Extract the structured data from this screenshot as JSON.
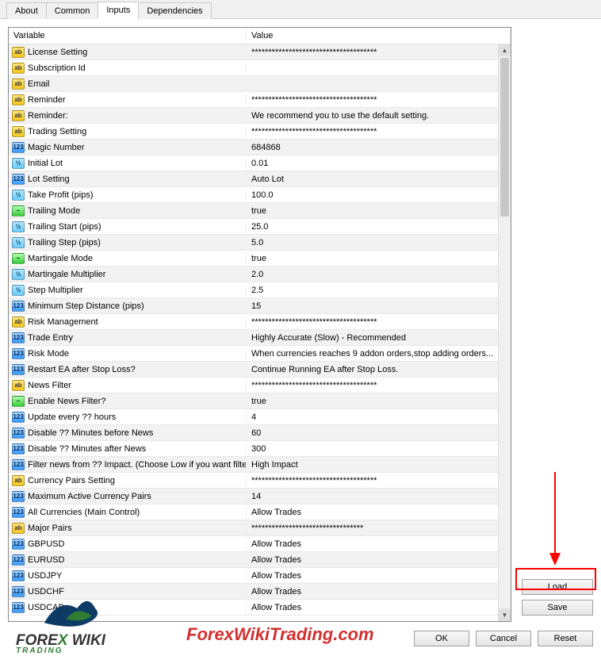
{
  "tabs": {
    "about": "About",
    "common": "Common",
    "inputs": "Inputs",
    "dependencies": "Dependencies"
  },
  "headers": {
    "variable": "Variable",
    "value": "Value"
  },
  "rows": [
    {
      "icon": "ab",
      "iconTxt": "ab",
      "var": "License Setting",
      "val": "*************************************"
    },
    {
      "icon": "ab",
      "iconTxt": "ab",
      "var": "Subscription Id",
      "val": ""
    },
    {
      "icon": "ab",
      "iconTxt": "ab",
      "var": "Email",
      "val": ""
    },
    {
      "icon": "ab",
      "iconTxt": "ab",
      "var": "Reminder",
      "val": "*************************************"
    },
    {
      "icon": "ab",
      "iconTxt": "ab",
      "var": "Reminder:",
      "val": "We recommend you to use the default setting."
    },
    {
      "icon": "ab",
      "iconTxt": "ab",
      "var": "Trading Setting",
      "val": "*************************************"
    },
    {
      "icon": "n123",
      "iconTxt": "123",
      "var": "Magic Number",
      "val": "684868"
    },
    {
      "icon": "half",
      "iconTxt": "½",
      "var": "Initial Lot",
      "val": "0.01"
    },
    {
      "icon": "n123",
      "iconTxt": "123",
      "var": "Lot Setting",
      "val": "Auto Lot"
    },
    {
      "icon": "half",
      "iconTxt": "½",
      "var": "Take Profit (pips)",
      "val": "100.0"
    },
    {
      "icon": "bool",
      "iconTxt": "~",
      "var": "Trailing Mode",
      "val": "true"
    },
    {
      "icon": "half",
      "iconTxt": "½",
      "var": "Trailing Start (pips)",
      "val": "25.0"
    },
    {
      "icon": "half",
      "iconTxt": "½",
      "var": "Trailing Step (pips)",
      "val": "5.0"
    },
    {
      "icon": "bool",
      "iconTxt": "~",
      "var": "Martingale Mode",
      "val": "true"
    },
    {
      "icon": "half",
      "iconTxt": "½",
      "var": "Martingale Multiplier",
      "val": "2.0"
    },
    {
      "icon": "half",
      "iconTxt": "½",
      "var": "Step Multiplier",
      "val": "2.5"
    },
    {
      "icon": "n123",
      "iconTxt": "123",
      "var": "Minimum Step Distance (pips)",
      "val": "15"
    },
    {
      "icon": "ab",
      "iconTxt": "ab",
      "var": "Risk Management",
      "val": "*************************************"
    },
    {
      "icon": "n123",
      "iconTxt": "123",
      "var": "Trade Entry",
      "val": "Highly Accurate (Slow) - Recommended"
    },
    {
      "icon": "n123",
      "iconTxt": "123",
      "var": "Risk Mode",
      "val": "When currencies reaches 9 addon orders,stop adding orders..."
    },
    {
      "icon": "n123",
      "iconTxt": "123",
      "var": "Restart EA after Stop Loss?",
      "val": "Continue Running EA after Stop Loss."
    },
    {
      "icon": "ab",
      "iconTxt": "ab",
      "var": "News Filter",
      "val": "*************************************"
    },
    {
      "icon": "bool",
      "iconTxt": "~",
      "var": "Enable News Filter?",
      "val": "true"
    },
    {
      "icon": "n123",
      "iconTxt": "123",
      "var": "Update every ?? hours",
      "val": "4"
    },
    {
      "icon": "n123",
      "iconTxt": "123",
      "var": "Disable ?? Minutes before News",
      "val": "60"
    },
    {
      "icon": "n123",
      "iconTxt": "123",
      "var": "Disable ?? Minutes after News",
      "val": "300"
    },
    {
      "icon": "n123",
      "iconTxt": "123",
      "var": "Filter news from ?? Impact. (Choose Low if you want filter...",
      "val": "High Impact"
    },
    {
      "icon": "ab",
      "iconTxt": "ab",
      "var": "Currency Pairs Setting",
      "val": "*************************************"
    },
    {
      "icon": "n123",
      "iconTxt": "123",
      "var": "Maximum Active Currency Pairs",
      "val": "14"
    },
    {
      "icon": "n123",
      "iconTxt": "123",
      "var": "All Currencies (Main Control)",
      "val": "Allow Trades"
    },
    {
      "icon": "ab",
      "iconTxt": "ab",
      "var": "Major Pairs",
      "val": "*********************************"
    },
    {
      "icon": "n123",
      "iconTxt": "123",
      "var": "GBPUSD",
      "val": "Allow Trades"
    },
    {
      "icon": "n123",
      "iconTxt": "123",
      "var": "EURUSD",
      "val": "Allow Trades"
    },
    {
      "icon": "n123",
      "iconTxt": "123",
      "var": "USDJPY",
      "val": "Allow Trades"
    },
    {
      "icon": "n123",
      "iconTxt": "123",
      "var": "USDCHF",
      "val": "Allow Trades"
    },
    {
      "icon": "n123",
      "iconTxt": "123",
      "var": "USDCAD",
      "val": "Allow Trades"
    }
  ],
  "buttons": {
    "load": "Load",
    "save": "Save",
    "ok": "OK",
    "cancel": "Cancel",
    "reset": "Reset"
  },
  "watermark": {
    "logo_fore": "FORE",
    "logo_x": "X",
    "logo_wiki": " WIKI",
    "logo_sub": "TRADING",
    "url": "ForexWikiTrading.com"
  }
}
